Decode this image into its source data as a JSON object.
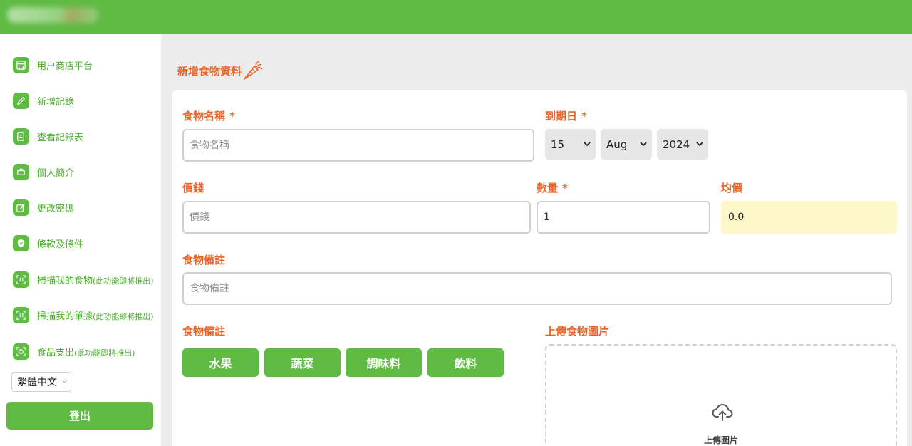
{
  "sidebar": {
    "items": [
      {
        "label": "用户商店平台",
        "sub": "",
        "icon": "store-icon"
      },
      {
        "label": "新增記錄",
        "sub": "",
        "icon": "pencil-icon"
      },
      {
        "label": "查看記錄表",
        "sub": "",
        "icon": "document-icon"
      },
      {
        "label": "個人簡介",
        "sub": "",
        "icon": "profile-icon"
      },
      {
        "label": "更改密碼",
        "sub": "",
        "icon": "edit-password-icon"
      },
      {
        "label": "條款及條件",
        "sub": "",
        "icon": "shield-icon"
      },
      {
        "label": "掃描我的食物",
        "sub": "(此功能即將推出)",
        "icon": "barcode-icon"
      },
      {
        "label": "掃描我的單據",
        "sub": "(此功能即將推出)",
        "icon": "barcode-icon"
      },
      {
        "label": "食品支出",
        "sub": "(此功能即將推出)",
        "icon": "receipt-scan-icon"
      }
    ],
    "language": "繁體中文",
    "logout_label": "登出"
  },
  "page": {
    "title": "新增食物資料",
    "title_icon": "carrot-icon"
  },
  "form": {
    "required_mark": "*",
    "food_name": {
      "label": "食物名稱",
      "placeholder": "食物名稱",
      "value": ""
    },
    "expiry": {
      "label": "到期日",
      "day": "15",
      "month": "Aug",
      "year": "2024"
    },
    "price": {
      "label": "價錢",
      "placeholder": "價錢",
      "value": ""
    },
    "quantity": {
      "label": "數量",
      "value": "1"
    },
    "unit_price": {
      "label": "均價",
      "value": "0.0"
    },
    "note": {
      "label": "食物備註",
      "placeholder": "食物備註",
      "value": ""
    },
    "category": {
      "label": "食物備註",
      "options": [
        "水果",
        "蔬菜",
        "調味料",
        "飲料"
      ]
    },
    "upload": {
      "label": "上傳食物圖片",
      "button_text": "上傳圖片",
      "icon": "cloud-upload-icon"
    }
  },
  "colors": {
    "brand_green": "#5fbb43",
    "accent_orange": "#e8662a",
    "highlight_yellow": "#fdf7c9"
  }
}
